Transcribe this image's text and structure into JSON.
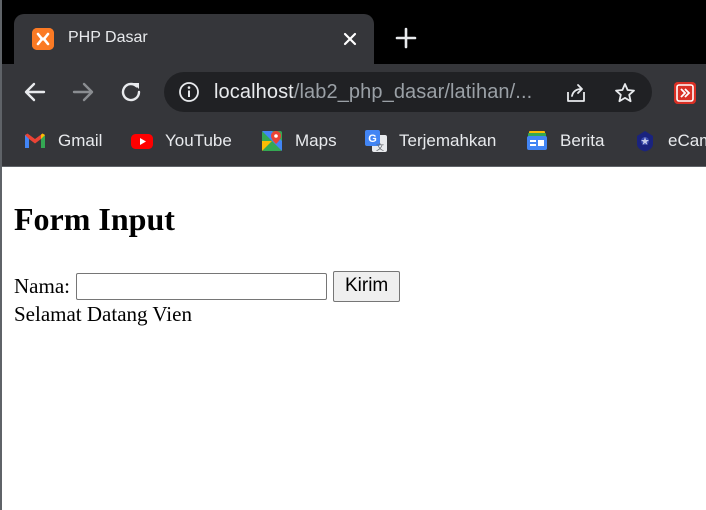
{
  "browser": {
    "tab": {
      "title": "PHP Dasar",
      "close_glyph": "✕"
    },
    "address_bar": {
      "host": "localhost",
      "path": "/lab2_php_dasar/latihan/..."
    },
    "bookmarks": [
      {
        "label": "Gmail",
        "icon": "gmail-icon"
      },
      {
        "label": "YouTube",
        "icon": "youtube-icon"
      },
      {
        "label": "Maps",
        "icon": "maps-icon"
      },
      {
        "label": "Terjemahkan",
        "icon": "translate-icon"
      },
      {
        "label": "Berita",
        "icon": "news-icon"
      },
      {
        "label": "eCam",
        "icon": "university-icon"
      }
    ]
  },
  "page": {
    "heading": "Form Input",
    "form": {
      "label": "Nama:",
      "input_value": "",
      "submit_label": "Kirim"
    },
    "greeting": "Selamat Datang Vien"
  },
  "colors": {
    "tabstrip_bg": "#000000",
    "toolbar_bg": "#35363a",
    "omnibox_bg": "#202124",
    "xampp_orange": "#fb7a24"
  }
}
